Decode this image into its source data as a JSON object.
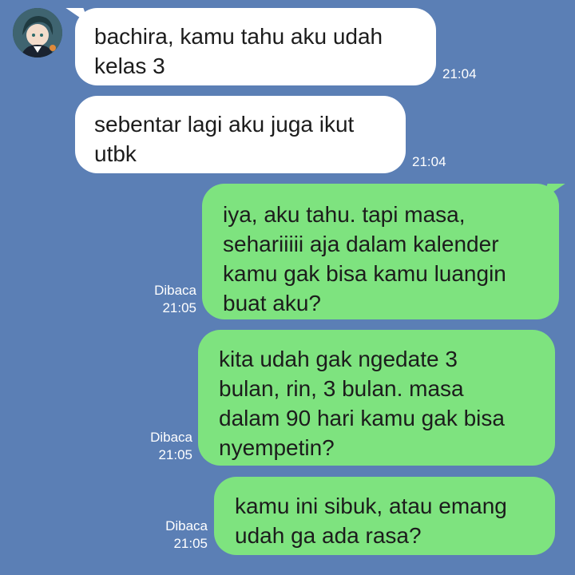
{
  "contact": {
    "avatar_icon": "anime-avatar"
  },
  "messages": [
    {
      "direction": "in",
      "text": "bachira, kamu tahu aku udah\nkelas 3",
      "time": "21:04"
    },
    {
      "direction": "in",
      "text": "sebentar lagi aku juga ikut\nutbk",
      "time": "21:04"
    },
    {
      "direction": "out",
      "text": "iya, aku tahu. tapi masa,\nsehariiiii aja dalam kalender\nkamu gak bisa kamu luangin\nbuat aku?",
      "read": "Dibaca",
      "time": "21:05"
    },
    {
      "direction": "out",
      "text": "kita udah gak ngedate 3\nbulan, rin, 3 bulan. masa\ndalam 90 hari kamu gak bisa\nnyempetin?",
      "read": "Dibaca",
      "time": "21:05"
    },
    {
      "direction": "out",
      "text": "kamu ini sibuk, atau emang\nudah ga ada rasa?",
      "read": "Dibaca",
      "time": "21:05"
    }
  ],
  "colors": {
    "background": "#5b7fb5",
    "incoming": "#ffffff",
    "outgoing": "#7ee37f"
  }
}
